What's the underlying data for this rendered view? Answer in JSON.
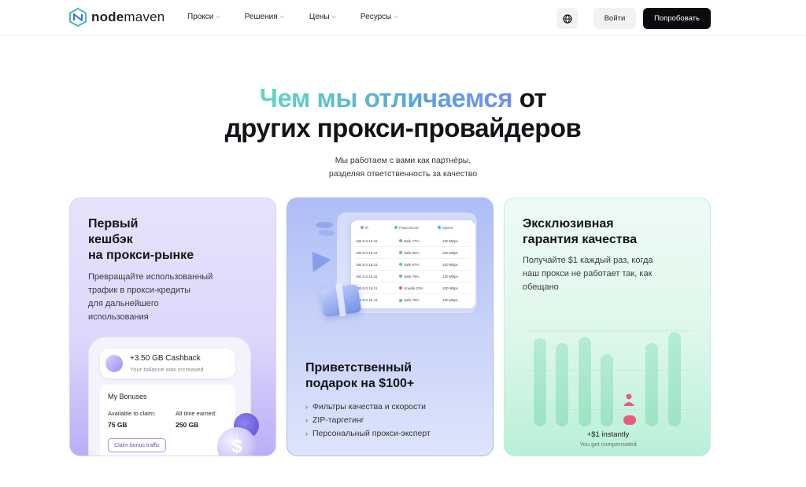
{
  "nav": {
    "logo_prefix": "node",
    "logo_suffix": "maven",
    "links": [
      {
        "label": "Прокси"
      },
      {
        "label": "Решения"
      },
      {
        "label": "Цены"
      },
      {
        "label": "Ресурсы"
      }
    ],
    "globe_icon": "globe-icon",
    "login_label": "Войти",
    "try_label": "Попробовать"
  },
  "hero": {
    "title_accent": "Чем мы отличаемся",
    "title_rest_1": " от",
    "title_line2": "других прокси-провайдеров",
    "subtitle_line1": "Мы работаем с вами как партнёры,",
    "subtitle_line2": "разделяя ответственность за качество"
  },
  "cards": {
    "cashback": {
      "title_1": "Первый",
      "title_2": "кешбэк",
      "title_3": "на прокси-рынке",
      "text_1": "Превращайте использованный",
      "text_2": "трафик в прокси-кредиты",
      "text_3": "для дальнейшего",
      "text_4": "использования",
      "pill_title": "+3.50 GB Cashback",
      "pill_sub": "Your balance was increased",
      "bonuses_title": "My Bonuses",
      "available_label": "Available to claim:",
      "available_value": "75 GB",
      "earned_label": "All time earned:",
      "earned_value": "250 GB",
      "claim_label": "Claim bonus traffic",
      "coin_symbol": "$"
    },
    "gift": {
      "table_headers": [
        "IP",
        "Fraud Score",
        "Speed"
      ],
      "rows": [
        {
          "ip": "192.0.0.16.41",
          "score": "Safe 77%",
          "speed": "100 Mbps",
          "color": "#5ac58f"
        },
        {
          "ip": "192.0.0.16.41",
          "score": "Safe 69%",
          "speed": "100 Mbps",
          "color": "#5ac58f"
        },
        {
          "ip": "192.0.0.16.41",
          "score": "Safe 87%",
          "speed": "100 Mbps",
          "color": "#5ac58f"
        },
        {
          "ip": "192.0.0.16.41",
          "score": "Safe 79%",
          "speed": "120 Mbps",
          "color": "#5ac58f"
        },
        {
          "ip": "192.0.0.16.41",
          "score": "Unsafe 23%",
          "speed": "100 Mbps",
          "color": "#e85a5a"
        },
        {
          "ip": "192.0.0.16.41",
          "score": "Safe 75%",
          "speed": "100 Mbps",
          "color": "#5ac58f"
        }
      ],
      "title_1": "Приветственный",
      "title_2": "подарок на $100+",
      "items": [
        {
          "label": "Фильтры качества и скорости"
        },
        {
          "label": "ZIP-таргетинг"
        },
        {
          "label": "Персональный прокси-эксперт"
        }
      ]
    },
    "guarantee": {
      "title_1": "Эксклюзивная",
      "title_2": "гарантия качества",
      "text_1": "Получайте $1 каждый раз, когда",
      "text_2": "наш прокси не работает так, как",
      "text_3": "обещано",
      "instant": "+$1 instantly",
      "compensated": "You get compensated"
    }
  }
}
